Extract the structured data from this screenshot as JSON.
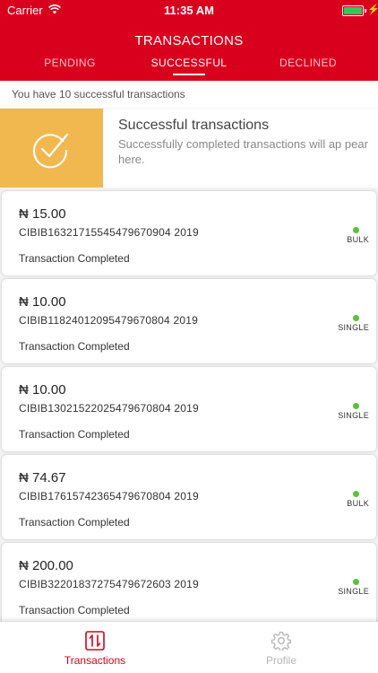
{
  "status_bar": {
    "carrier": "Carrier",
    "time": "11:35 AM"
  },
  "header": {
    "title": "TRANSACTIONS"
  },
  "tabs": [
    {
      "label": "PENDING"
    },
    {
      "label": "SUCCESSFUL"
    },
    {
      "label": "DECLINED"
    }
  ],
  "summary": {
    "text": "You have 10 successful transactions"
  },
  "banner": {
    "title": "Successful transactions",
    "description": "Successfully completed transactions will ap pear here."
  },
  "transactions": [
    {
      "amount": "₦ 15.00",
      "reference": "CIBIB16321715545479670904 2019",
      "status": "Transaction Completed",
      "type": "BULK"
    },
    {
      "amount": "₦ 10.00",
      "reference": "CIBIB11824012095479670804 2019",
      "status": "Transaction Completed",
      "type": "SINGLE"
    },
    {
      "amount": "₦ 10.00",
      "reference": "CIBIB13021522025479670804 2019",
      "status": "Transaction Completed",
      "type": "SINGLE"
    },
    {
      "amount": "₦ 74.67",
      "reference": "CIBIB17615742365479670804 2019",
      "status": "Transaction Completed",
      "type": "BULK"
    },
    {
      "amount": "₦ 200.00",
      "reference": "CIBIB32201837275479672603 2019",
      "status": "Transaction Completed",
      "type": "SINGLE"
    }
  ],
  "bottom_nav": [
    {
      "label": "Transactions"
    },
    {
      "label": "Profile"
    }
  ],
  "colors": {
    "brand": "#d9001e",
    "banner": "#f2b850",
    "success_dot": "#5bc236",
    "inactive": "#b5b5b5"
  }
}
